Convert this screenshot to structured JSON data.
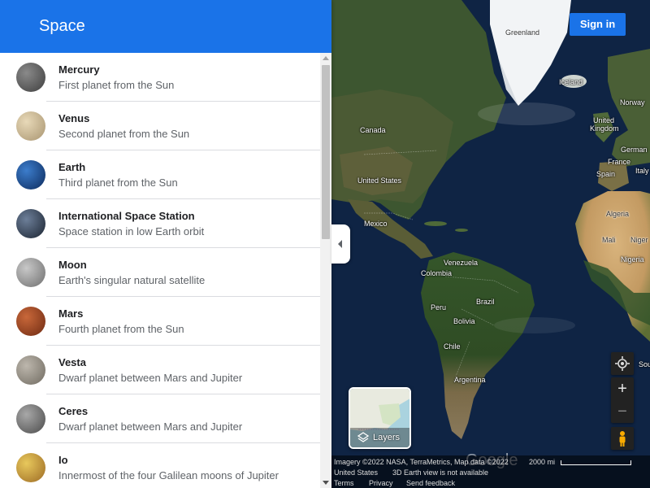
{
  "panel": {
    "title": "Space"
  },
  "items": [
    {
      "name": "Mercury",
      "description": "First planet from the Sun",
      "colors": [
        "#8a8a8a",
        "#3e3e3e"
      ]
    },
    {
      "name": "Venus",
      "description": "Second planet from the Sun",
      "colors": [
        "#e8d9b8",
        "#a89470"
      ]
    },
    {
      "name": "Earth",
      "description": "Third planet from the Sun",
      "colors": [
        "#3c7dcc",
        "#0c2a5c"
      ]
    },
    {
      "name": "International Space Station",
      "description": "Space station in low Earth orbit",
      "colors": [
        "#6d7f99",
        "#1a2330"
      ]
    },
    {
      "name": "Moon",
      "description": "Earth's singular natural satellite",
      "colors": [
        "#c8c8c8",
        "#6e6e6e"
      ]
    },
    {
      "name": "Mars",
      "description": "Fourth planet from the Sun",
      "colors": [
        "#c9683a",
        "#6e2a12"
      ]
    },
    {
      "name": "Vesta",
      "description": "Dwarf planet between Mars and Jupiter",
      "colors": [
        "#bdb7ad",
        "#6f6a60"
      ]
    },
    {
      "name": "Ceres",
      "description": "Dwarf planet between Mars and Jupiter",
      "colors": [
        "#a8a8a8",
        "#4a4a4a"
      ]
    },
    {
      "name": "Io",
      "description": "Innermost of the four Galilean moons of Jupiter",
      "colors": [
        "#e8c85c",
        "#9c6a24"
      ]
    }
  ],
  "map": {
    "signin_label": "Sign in",
    "labels": {
      "greenland": "Greenland",
      "iceland": "Iceland",
      "canada": "Canada",
      "norway": "Norway",
      "united_kingdom_1": "United",
      "united_kingdom_2": "Kingdom",
      "germany": "German",
      "france": "France",
      "spain": "Spain",
      "italy": "Italy",
      "united_states": "United States",
      "mexico": "Mexico",
      "algeria": "Algeria",
      "mali": "Mali",
      "niger": "Niger",
      "nigeria": "Nigeria",
      "venezuela": "Venezuela",
      "colombia": "Colombia",
      "brazil": "Brazil",
      "peru": "Peru",
      "bolivia": "Bolivia",
      "chile": "Chile",
      "argentina": "Argentina",
      "south_partial": "Sou"
    },
    "layers_label": "Layers",
    "google_label": "Google",
    "controls": {
      "zoom_in": "+",
      "zoom_out": "−"
    },
    "footer": {
      "attribution": "Imagery ©2022 NASA, TerraMetrics, Map data ©2022",
      "scale_label": "2000 mi",
      "region": "United States",
      "notice": "3D Earth view is not available",
      "terms": "Terms",
      "privacy": "Privacy",
      "feedback": "Send feedback"
    },
    "colors": {
      "ocean": "#0f2444",
      "land": "#3f5a2c",
      "desert": "#c9a46c",
      "ice": "#f2f4f6",
      "accent": "#1a73e8"
    }
  }
}
